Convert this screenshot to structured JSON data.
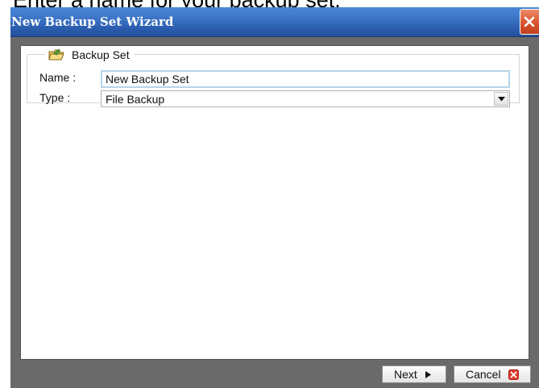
{
  "caption": "Enter a name for your backup set.",
  "window": {
    "title": "New Backup Set Wizard"
  },
  "group": {
    "title": "Backup Set"
  },
  "form": {
    "name_label": "Name :",
    "name_value": "New Backup Set",
    "type_label": "Type :",
    "type_value": "File Backup"
  },
  "buttons": {
    "next_label": "Next",
    "cancel_label": "Cancel"
  },
  "icons": {
    "group": "folder-icon",
    "close": "close-icon",
    "next": "arrow-right-icon",
    "cancel": "cancel-x-icon",
    "dropdown": "chevron-down-icon"
  },
  "colors": {
    "titlebar": "#2c5fb0",
    "close_button": "#d9542e",
    "frame": "#6a6a6a"
  }
}
